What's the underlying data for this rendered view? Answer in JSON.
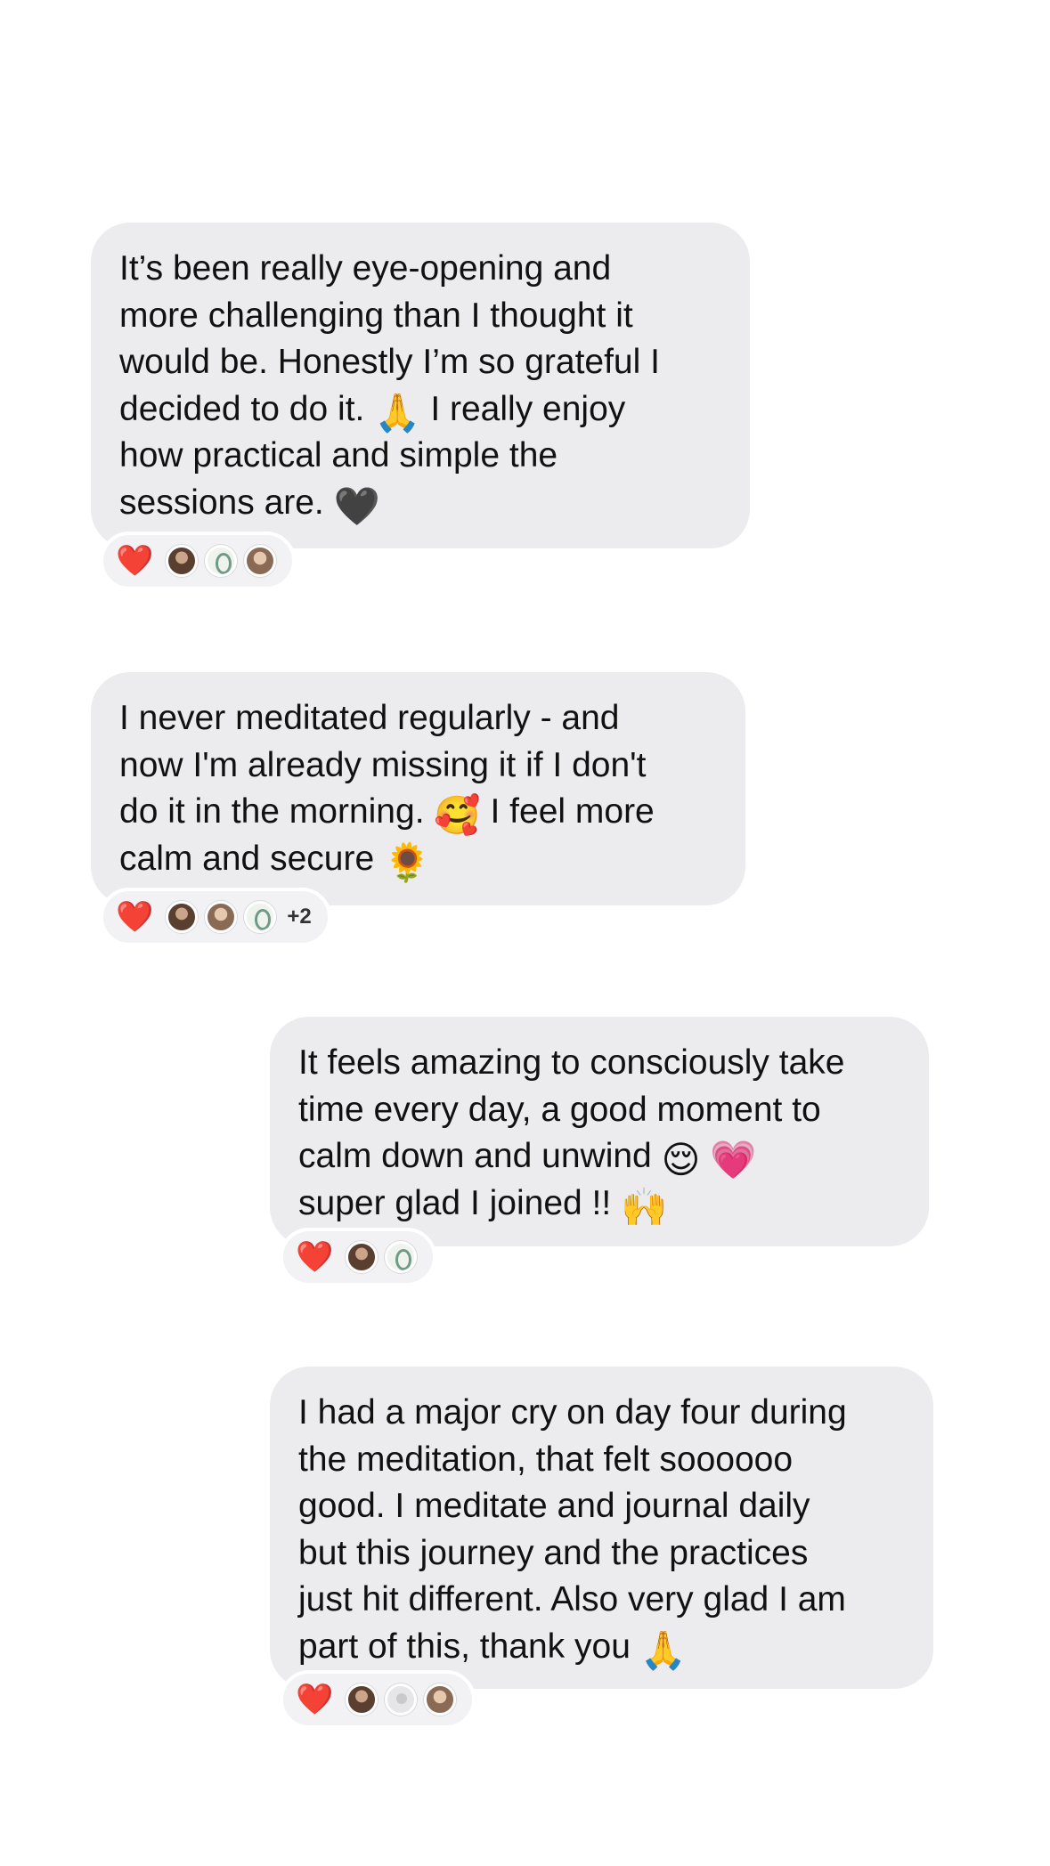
{
  "messages": [
    {
      "text_1": "It’s been really eye-opening and\nmore challenging than I thought it\nwould be. Honestly I’m so grateful I\ndecided to do it. ",
      "emoji_1": "🙏",
      "text_2": " I really enjoy\nhow practical and simple the\nsessions are. ",
      "emoji_2": "🖤",
      "reaction": "❤️"
    },
    {
      "text_1": "I never meditated regularly - and\nnow I'm already missing it if I don't\ndo it in the morning. ",
      "emoji_1": "🥰",
      "text_2": " I feel more\ncalm and secure ",
      "emoji_2": "🌻",
      "reaction": "❤️",
      "more_count": "+2"
    },
    {
      "text_1": "It feels amazing to consciously take\ntime every day, a good moment to\ncalm down and unwind ",
      "emoji_1": "😌",
      "emoji_2": "💗",
      "text_2": "\nsuper glad I joined !! ",
      "emoji_3": "🙌",
      "reaction": "❤️"
    },
    {
      "text_1": "I had a major cry on day four during\nthe meditation, that felt soooooo\ngood. I meditate and journal daily\nbut this journey and the practices\njust hit different. Also very glad I am\npart of this, thank you ",
      "emoji_1": "🙏",
      "reaction": "❤️"
    }
  ],
  "colors": {
    "bubble": "#ececee",
    "text": "#111111",
    "heart": "#e0213a"
  }
}
